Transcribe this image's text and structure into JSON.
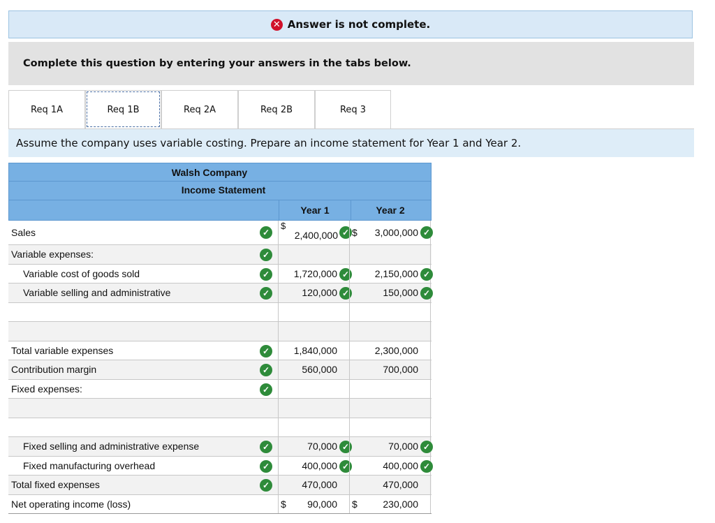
{
  "banner": {
    "text": "Answer is not complete.",
    "icon": "x-circle-icon",
    "color": "#d0112b"
  },
  "instruction": "Complete this question by entering your answers in the tabs below.",
  "tabs": [
    {
      "label": "Req 1A",
      "active": false
    },
    {
      "label": "Req 1B",
      "active": true
    },
    {
      "label": "Req 2A",
      "active": false
    },
    {
      "label": "Req 2B",
      "active": false
    },
    {
      "label": "Req 3",
      "active": false
    }
  ],
  "prompt": "Assume the company uses variable costing. Prepare an income statement for Year 1 and Year 2.",
  "statement": {
    "company": "Walsh Company",
    "title": "Income Statement",
    "col1": "Year 1",
    "col2": "Year 2",
    "rows": {
      "sales": {
        "label": "Sales",
        "y1_sign": "$",
        "y1": "2,400,000",
        "y2_sign": "$",
        "y2": "3,000,000"
      },
      "variable_expenses": {
        "label": "Variable expenses:"
      },
      "vcogs": {
        "label": "Variable cost of goods sold",
        "y1": "1,720,000",
        "y2": "2,150,000"
      },
      "vsga": {
        "label": "Variable selling and administrative",
        "y1": "120,000",
        "y2": "150,000"
      },
      "total_var": {
        "label": "Total variable expenses",
        "y1": "1,840,000",
        "y2": "2,300,000"
      },
      "contribution": {
        "label": "Contribution margin",
        "y1": "560,000",
        "y2": "700,000"
      },
      "fixed_expenses": {
        "label": "Fixed expenses:"
      },
      "fsga": {
        "label": "Fixed selling and administrative expense",
        "y1": "70,000",
        "y2": "70,000"
      },
      "fmoh": {
        "label": "Fixed manufacturing overhead",
        "y1": "400,000",
        "y2": "400,000"
      },
      "total_fixed": {
        "label": "Total fixed expenses",
        "y1": "470,000",
        "y2": "470,000"
      },
      "noi": {
        "label": "Net operating income (loss)",
        "y1_sign": "$",
        "y1": "90,000",
        "y2_sign": "$",
        "y2": "230,000"
      }
    }
  },
  "colors": {
    "header_blue": "#77b0e3",
    "check_green": "#2e8b3a",
    "prompt_bg": "#deedf8"
  }
}
